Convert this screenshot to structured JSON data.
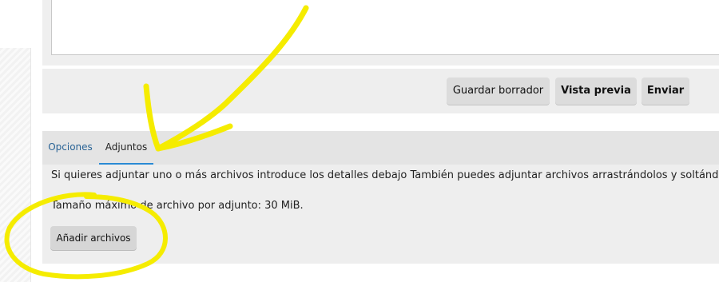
{
  "toolbar": {
    "save_draft_label": "Guardar borrador",
    "preview_label": "Vista previa",
    "send_label": "Enviar"
  },
  "tabs": [
    {
      "label": "Opciones"
    },
    {
      "label": "Adjuntos"
    }
  ],
  "attachments": {
    "info_text": "Si quieres adjuntar uno o más archivos introduce los detalles debajo También puedes adjuntar archivos arrastrándolos y soltándolos",
    "max_size_text": "Tamaño máximo de archivo por adjunto: 30 MiB.",
    "add_files_label": "Añadir archivos"
  },
  "colors": {
    "annotation_highlight": "#f5ec00",
    "active_tab_underline": "#2a8ad4",
    "link_color": "#2a6496"
  }
}
